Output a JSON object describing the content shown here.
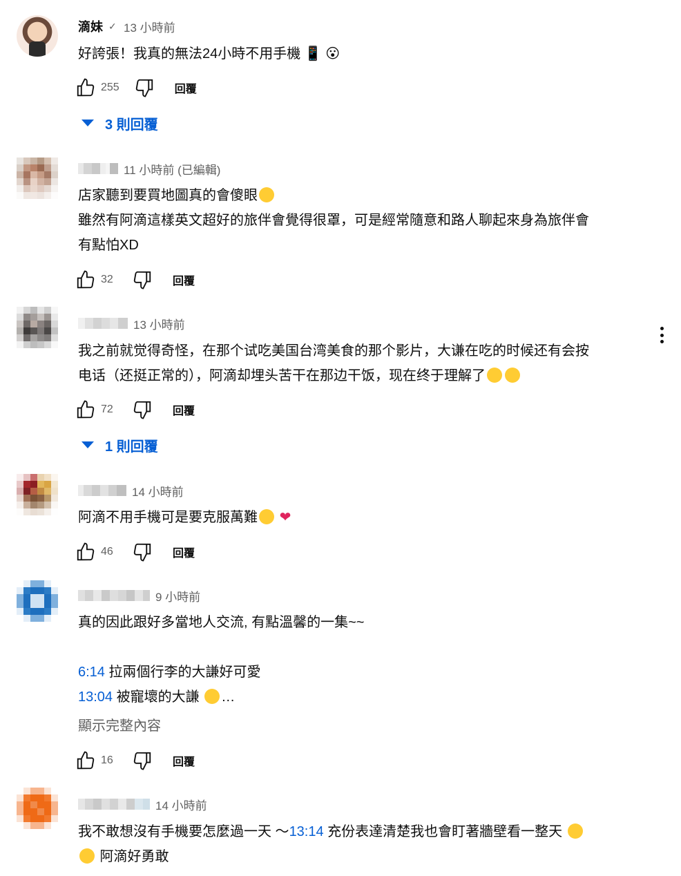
{
  "comments": [
    {
      "author": "滴妹",
      "verified": true,
      "time": "13 小時前",
      "text": "好誇張！我真的無法24小時不用手機",
      "text_suffix": "📱 😮",
      "likes": "255",
      "reply_label": "回覆",
      "replies_label": "3 則回覆"
    },
    {
      "time": "11 小時前 (已編輯)",
      "line1": "店家聽到要買地圖真的會傻眼",
      "line2": "雖然有阿滴這樣英文超好的旅伴會覺得很罩，可是經常隨意和路人聊起來身為旅伴會",
      "line3": "有點怕XD",
      "likes": "32",
      "reply_label": "回覆"
    },
    {
      "time": "13 小時前",
      "line1": "我之前就觉得奇怪，在那个试吃美国台湾美食的那个影片，大谦在吃的时候还有会按",
      "line2": "电话（还挺正常的），阿滴却埋头苦干在那边干饭，现在终于理解了",
      "likes": "72",
      "reply_label": "回覆",
      "replies_label": "1 則回覆"
    },
    {
      "time": "14 小時前",
      "line1": "阿滴不用手機可是要克服萬難",
      "likes": "46",
      "reply_label": "回覆"
    },
    {
      "time": "9 小時前",
      "line1": "真的因此跟好多當地人交流, 有點溫馨的一集~~",
      "ts1": "6:14",
      "ts1_text": " 拉兩個行李的大謙好可愛",
      "ts2": "13:04",
      "ts2_text": " 被寵壞的大謙",
      "ellipsis": "…",
      "show_more": "顯示完整內容",
      "likes": "16",
      "reply_label": "回覆"
    },
    {
      "time": "14 小時前",
      "line1_a": "我不敢想沒有手機要怎麼過一天 ～",
      "ts": "13:14",
      "line1_b": " 充份表達清楚我也會盯著牆壁看一整天",
      "line2": " 阿滴好勇敢"
    }
  ],
  "colors": {
    "link": "#065fd4",
    "meta": "#606060",
    "text": "#0f0f0f"
  },
  "icons": [
    "thumb-up-icon",
    "thumb-down-icon",
    "caret-down-icon",
    "more-vert-icon",
    "verified-check-icon"
  ]
}
